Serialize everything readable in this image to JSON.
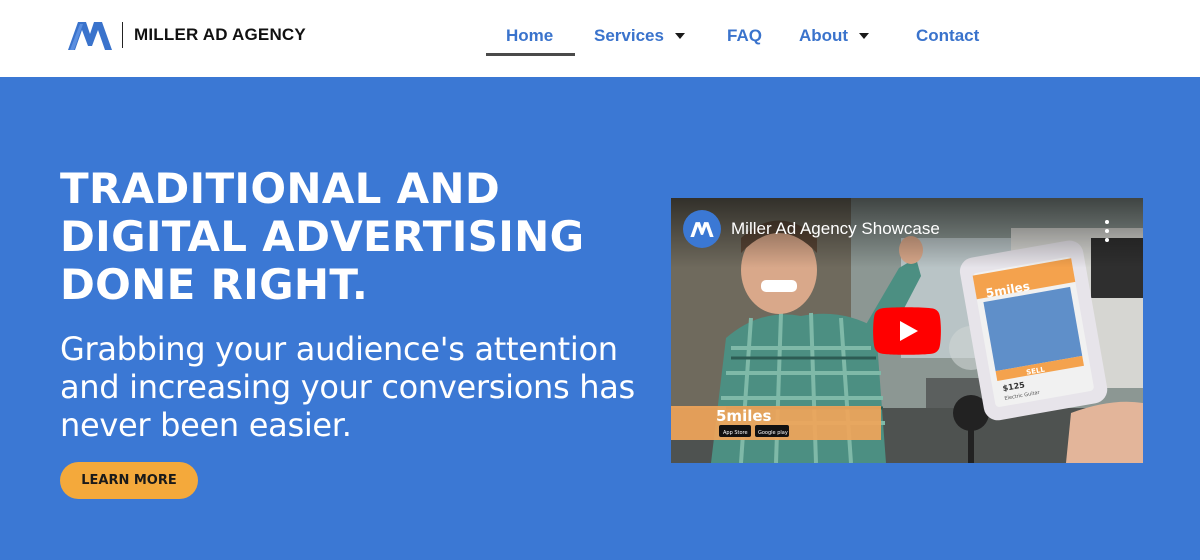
{
  "brand": {
    "name": "MILLER AD AGENCY",
    "logo_icon": "miller-m-logo",
    "color": "#3a73cc"
  },
  "nav": {
    "items": [
      {
        "label": "Home",
        "active": true,
        "has_dropdown": false
      },
      {
        "label": "Services",
        "active": false,
        "has_dropdown": true
      },
      {
        "label": "FAQ",
        "active": false,
        "has_dropdown": false
      },
      {
        "label": "About",
        "active": false,
        "has_dropdown": true
      },
      {
        "label": "Contact",
        "active": false,
        "has_dropdown": false
      }
    ],
    "link_color": "#3a73cc",
    "active_indicator_color": "#4a4a4a"
  },
  "hero": {
    "title_lines": [
      "TRADITIONAL AND",
      "DIGITAL ADVERTISING",
      "DONE RIGHT."
    ],
    "subtitle_lines": [
      "Grabbing your audience's attention",
      "and increasing your conversions has",
      "never been easier."
    ],
    "cta_label": "LEARN MORE",
    "background_color": "#3b78d4",
    "cta_color": "#f4a93b"
  },
  "video": {
    "title": "Miller Ad Agency Showcase",
    "channel_icon": "miller-m-logo",
    "play_icon": "youtube-play-icon",
    "menu_icon": "more-vertical-icon",
    "frame_overlay_text": {
      "brand": "5miles",
      "app_store": "App Store",
      "google_play": "Google play",
      "price": "$125",
      "item": "Electric Guitar",
      "action": "SELL"
    },
    "play_color": "#ff0000"
  }
}
